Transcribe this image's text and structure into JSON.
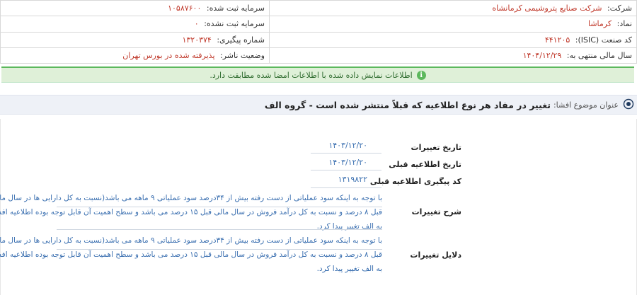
{
  "company_info": {
    "company_label": "شرکت:",
    "company_value": "شرکت صنایع پتروشیمی کرمانشاه",
    "capital_registered_label": "سرمایه ثبت شده:",
    "capital_registered_value": "۱۰۵۸۷۶۰۰",
    "symbol_label": "نماد:",
    "symbol_value": "کرماشا",
    "capital_unregistered_label": "سرمایه ثبت نشده:",
    "capital_unregistered_value": "۰",
    "isic_label": "کد صنعت (ISIC):",
    "isic_value": "۴۴۱۲۰۵",
    "tracking_label": "شماره پیگیری:",
    "tracking_value": "۱۳۲۰۳۷۴",
    "fiscal_year_label": "سال مالی منتهی به:",
    "fiscal_year_value": "۱۴۰۴/۱۲/۲۹",
    "publisher_status_label": "وضعیت ناشر:",
    "publisher_status_value": "پذیرفته شده در بورس تهران"
  },
  "notice": {
    "icon": "info-icon",
    "text": "اطلاعات نمایش داده شده با اطلاعات امضا شده مطابقت دارد."
  },
  "subject": {
    "icon": "target-icon",
    "label": "عنوان موضوع افشا:",
    "value": "تغییر در مفاد هر نوع اطلاعیه که قبلاً منتشر شده است - گروه الف"
  },
  "details": {
    "change_date_label": "تاریخ تغییرات",
    "change_date_value": "۱۴۰۳/۱۲/۲۰",
    "prev_notice_date_label": "تاریخ اطلاعیه قبلی",
    "prev_notice_date_value": "۱۴۰۳/۱۲/۲۰",
    "prev_tracking_label": "کد پیگیری اطلاعیه قبلی",
    "prev_tracking_value": "۱۳۱۹۸۲۲",
    "change_desc_label": "شرح تغییرات",
    "change_desc_lines": [
      "با توجه به اینکه سود عملیاتی از دست رفته بیش از ۳۴درصد سود عملیاتی ۹ ماهه می باشد(نسبت به کل دارایی ها در سال مالی",
      "قبل ۸ درصد و نسبت به کل درآمد فروش در سال مالی قبل ۱۵ درصد می باشد و سطح اهمیت آن قابل توجه بوده اطلاعیه افشا از ب",
      "به الف تغییر پیدا کرد."
    ],
    "change_reason_label": "دلایل تغییرات",
    "change_reason_lines": [
      "با توجه به اینکه سود عملیاتی از دست رفته بیش از ۳۴درصد سود عملیاتی ۹ ماهه می باشد(نسبت به کل دارایی ها در سال مالی",
      "قبل ۸ درصد و نسبت به کل درآمد فروش در سال مالی قبل ۱۵ درصد می باشد و سطح اهمیت آن قابل توجه بوده اطلاعیه افشا از ب",
      "به الف تغییر پیدا کرد."
    ]
  }
}
